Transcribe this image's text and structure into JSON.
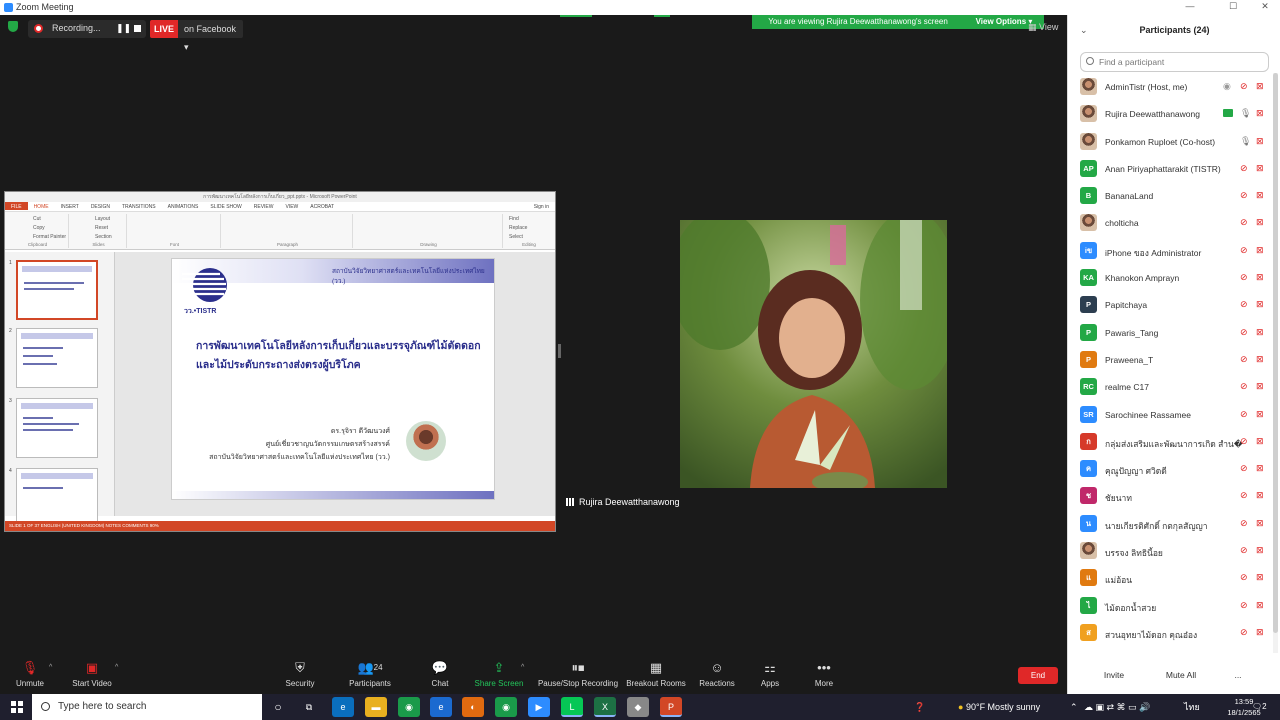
{
  "window": {
    "title": "Zoom Meeting",
    "viewing_banner": "You are viewing Rujira Deewatthanawong's screen",
    "view_options": "View Options",
    "view_button": "View"
  },
  "status": {
    "recording_label": "Recording...",
    "live_label": "LIVE",
    "live_target": "on Facebook"
  },
  "shared_screen": {
    "app_title": "การพัฒนาเทคโนโลยีหลังการเก็บเกี่ยว_ppt.pptx - Microsoft PowerPoint",
    "tabs": [
      "FILE",
      "HOME",
      "INSERT",
      "DESIGN",
      "TRANSITIONS",
      "ANIMATIONS",
      "SLIDE SHOW",
      "REVIEW",
      "VIEW",
      "ACROBAT"
    ],
    "signin": "Sign in",
    "ribbon_groups": [
      "Clipboard",
      "Slides",
      "Font",
      "Paragraph",
      "Drawing",
      "Editing"
    ],
    "clipboard_items": [
      "Cut",
      "Copy",
      "Format Painter"
    ],
    "slides_items": [
      "Layout",
      "Reset",
      "Section"
    ],
    "editing_items": [
      "Find",
      "Replace",
      "Select"
    ],
    "thumbnail_numbers": [
      "1",
      "2",
      "3",
      "4"
    ],
    "slide": {
      "org_top": "สถาบันวิจัยวิทยาศาสตร์และเทคโนโลยีแห่งประเทศไทย (วว.)",
      "logo_text": "วว.•TISTR",
      "title_line1": "การพัฒนาเทคโนโลยีหลังการเก็บเกี่ยวและบรรจุภัณฑ์ไม้ตัดดอก",
      "title_line2": "และไม้ประดับกระถางส่งตรงผู้บริโภค",
      "author_line1": "ดร.รุจิรา ดีวัฒนวงศ์",
      "author_line2": "ศูนย์เชี่ยวชาญนวัตกรรมเกษตรสร้างสรรค์",
      "author_line3": "สถาบันวิจัยวิทยาศาสตร์และเทคโนโลยีแห่งประเทศไทย (วว.)"
    },
    "status_bar": "SLIDE 1 OF 37     ENGLISH (UNITED KINGDOM)                                                                                                NOTES     COMMENTS                                                   90%"
  },
  "video": {
    "name": "Rujira Deewatthanawong"
  },
  "toolbar": {
    "unmute": "Unmute",
    "start_video": "Start Video",
    "security": "Security",
    "participants": "Participants",
    "participants_count": "24",
    "chat": "Chat",
    "share_screen": "Share Screen",
    "pause_stop_recording": "Pause/Stop Recording",
    "breakout_rooms": "Breakout Rooms",
    "reactions": "Reactions",
    "apps": "Apps",
    "more": "More",
    "end": "End"
  },
  "participants_panel": {
    "title": "Participants (24)",
    "search_placeholder": "Find a participant",
    "list": [
      {
        "name": "AdminTistr (Host, me)",
        "initials": "",
        "color": "",
        "photo": true,
        "extra": "record"
      },
      {
        "name": "Rujira Deewatthanawong",
        "initials": "",
        "color": "",
        "photo": true,
        "extra": "share"
      },
      {
        "name": "Ponkamon Ruploet (Co-host)",
        "initials": "",
        "color": "",
        "photo": true,
        "extra": "mic"
      },
      {
        "name": "Anan Piriyaphattarakit (TISTR)",
        "initials": "AP",
        "color": "#23a846",
        "photo": false,
        "extra": ""
      },
      {
        "name": "BananaLand",
        "initials": "B",
        "color": "#23a846",
        "photo": false,
        "extra": ""
      },
      {
        "name": "cholticha",
        "initials": "",
        "color": "",
        "photo": true,
        "extra": ""
      },
      {
        "name": "iPhone ของ Administrator",
        "initials": "iข",
        "color": "#2d8cff",
        "photo": false,
        "extra": ""
      },
      {
        "name": "Khanokon Amprayn",
        "initials": "KA",
        "color": "#23a846",
        "photo": false,
        "extra": ""
      },
      {
        "name": "Papitchaya",
        "initials": "P",
        "color": "#2c3e50",
        "photo": false,
        "extra": ""
      },
      {
        "name": "Pawaris_Tang",
        "initials": "P",
        "color": "#23a846",
        "photo": false,
        "extra": ""
      },
      {
        "name": "Praweena_T",
        "initials": "P",
        "color": "#e07a10",
        "photo": false,
        "extra": ""
      },
      {
        "name": "realme C17",
        "initials": "RC",
        "color": "#23a846",
        "photo": false,
        "extra": ""
      },
      {
        "name": "Sarochinee Rassamee",
        "initials": "SR",
        "color": "#2d8cff",
        "photo": false,
        "extra": ""
      },
      {
        "name": "กลุ่มส่งเสริมและพัฒนาการเกิด สำน�",
        "initials": "ก",
        "color": "#d63a2a",
        "photo": false,
        "extra": ""
      },
      {
        "name": "คุณูปัญญา ศวิดดี",
        "initials": "ค",
        "color": "#2d8cff",
        "photo": false,
        "extra": ""
      },
      {
        "name": "ชัยนาท",
        "initials": "ช",
        "color": "#c0286a",
        "photo": false,
        "extra": ""
      },
      {
        "name": "นายเกียรติศักดิ์ กตกุลสัญญา",
        "initials": "น",
        "color": "#2d8cff",
        "photo": false,
        "extra": ""
      },
      {
        "name": "บรรจง ลิทธินี้อย",
        "initials": "",
        "color": "",
        "photo": true,
        "extra": ""
      },
      {
        "name": "แม่อ้อน",
        "initials": "แ",
        "color": "#e07a10",
        "photo": false,
        "extra": ""
      },
      {
        "name": "ไม้ดอกน้ำสวย",
        "initials": "ไ",
        "color": "#23a846",
        "photo": false,
        "extra": ""
      },
      {
        "name": "สวนอุทยาไม้ดอก คุณอ๋อง",
        "initials": "ส",
        "color": "#f0a020",
        "photo": false,
        "extra": ""
      }
    ],
    "invite": "Invite",
    "mute_all": "Mute All",
    "more": "..."
  },
  "taskbar": {
    "search_placeholder": "Type here to search",
    "weather": "90°F  Mostly sunny",
    "language": "ไทย",
    "time": "13:59",
    "date": "18/1/2565",
    "notifications": "2"
  },
  "colors": {
    "zoom_green": "#23a846",
    "zoom_red": "#e02828",
    "ppt_orange": "#d24726",
    "tistr_blue": "#2b2f8c"
  }
}
